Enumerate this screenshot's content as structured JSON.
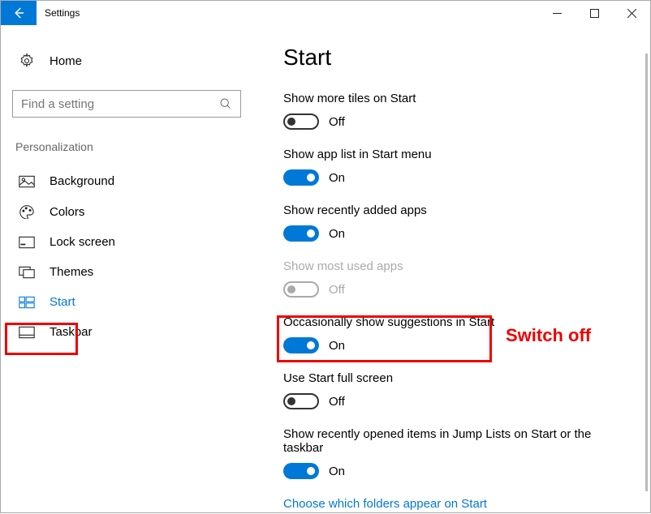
{
  "titlebar": {
    "app_title": "Settings"
  },
  "sidebar": {
    "home": "Home",
    "search_placeholder": "Find a setting",
    "section": "Personalization",
    "items": [
      {
        "label": "Background"
      },
      {
        "label": "Colors"
      },
      {
        "label": "Lock screen"
      },
      {
        "label": "Themes"
      },
      {
        "label": "Start"
      },
      {
        "label": "Taskbar"
      }
    ]
  },
  "main": {
    "heading": "Start",
    "settings": [
      {
        "label": "Show more tiles on Start",
        "state": "Off"
      },
      {
        "label": "Show app list in Start menu",
        "state": "On"
      },
      {
        "label": "Show recently added apps",
        "state": "On"
      },
      {
        "label": "Show most used apps",
        "state": "Off"
      },
      {
        "label": "Occasionally show suggestions in Start",
        "state": "On"
      },
      {
        "label": "Use Start full screen",
        "state": "Off"
      },
      {
        "label": "Show recently opened items in Jump Lists on Start or the taskbar",
        "state": "On"
      }
    ],
    "link": "Choose which folders appear on Start"
  },
  "annotation": {
    "switch_off": "Switch off"
  }
}
